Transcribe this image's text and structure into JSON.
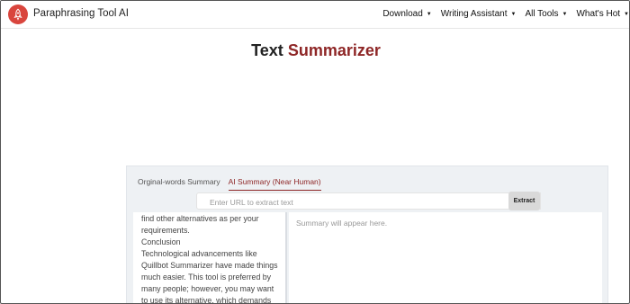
{
  "header": {
    "brand": "Paraphrasing Tool AI",
    "logo_icon": "rocket-icon",
    "brand_color": "#d9453d",
    "menu": [
      {
        "label": "Download"
      },
      {
        "label": "Writing Assistant"
      },
      {
        "label": "All Tools"
      },
      {
        "label": "What's Hot"
      }
    ]
  },
  "title": {
    "part1": "Text",
    "part2": "Summarizer",
    "accent_color": "#8e2626"
  },
  "tool": {
    "tabs": [
      {
        "label": "Orginal-words Summary",
        "active": false
      },
      {
        "label": "AI Summary (Near Human)",
        "active": true
      }
    ],
    "url_placeholder": "Enter URL to extract text",
    "extract_label": "Extract",
    "input_lines": [
      "find other alternatives as per your",
      "requirements.",
      "Conclusion",
      "Technological advancements like",
      "Quillbot Summarizer have made things",
      "much easier. This tool is preferred by",
      "many people; however, you may want",
      "to use its alternative, which demands"
    ],
    "summary_placeholder": "Summary will appear here."
  }
}
